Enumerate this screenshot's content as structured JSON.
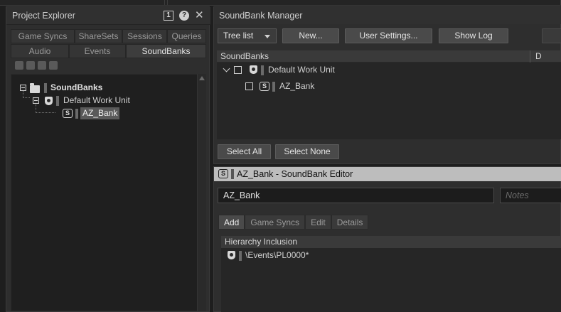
{
  "project_explorer": {
    "title": "Project Explorer",
    "top_tabs": [
      "Game Syncs",
      "ShareSets",
      "Sessions",
      "Queries"
    ],
    "bottom_tabs": [
      "Audio",
      "Events",
      "SoundBanks"
    ],
    "active_tab": "SoundBanks",
    "badge": "1",
    "help_glyph": "?",
    "close_glyph": "✕",
    "tree": {
      "root": "SoundBanks",
      "work_unit": "Default Work Unit",
      "bank": "AZ_Bank"
    }
  },
  "soundbank_manager": {
    "title": "SoundBank Manager",
    "view_select": "Tree list",
    "new_button": "New...",
    "user_settings_button": "User Settings...",
    "show_log_button": "Show Log",
    "column_soundbanks": "SoundBanks",
    "column_d": "D",
    "rows": {
      "work_unit": "Default Work Unit",
      "bank": "AZ_Bank"
    },
    "select_all_button": "Select All",
    "select_none_button": "Select None"
  },
  "soundbank_editor": {
    "title": "AZ_Bank - SoundBank Editor",
    "name_value": "AZ_Bank",
    "notes_placeholder": "Notes",
    "tabs": [
      "Add",
      "Game Syncs",
      "Edit",
      "Details"
    ],
    "active_tab": "Add",
    "hierarchy_header": "Hierarchy Inclusion",
    "hierarchy_item": "\\Events\\PL0000*"
  },
  "icons": {
    "bank_icon_glyph": "S"
  }
}
